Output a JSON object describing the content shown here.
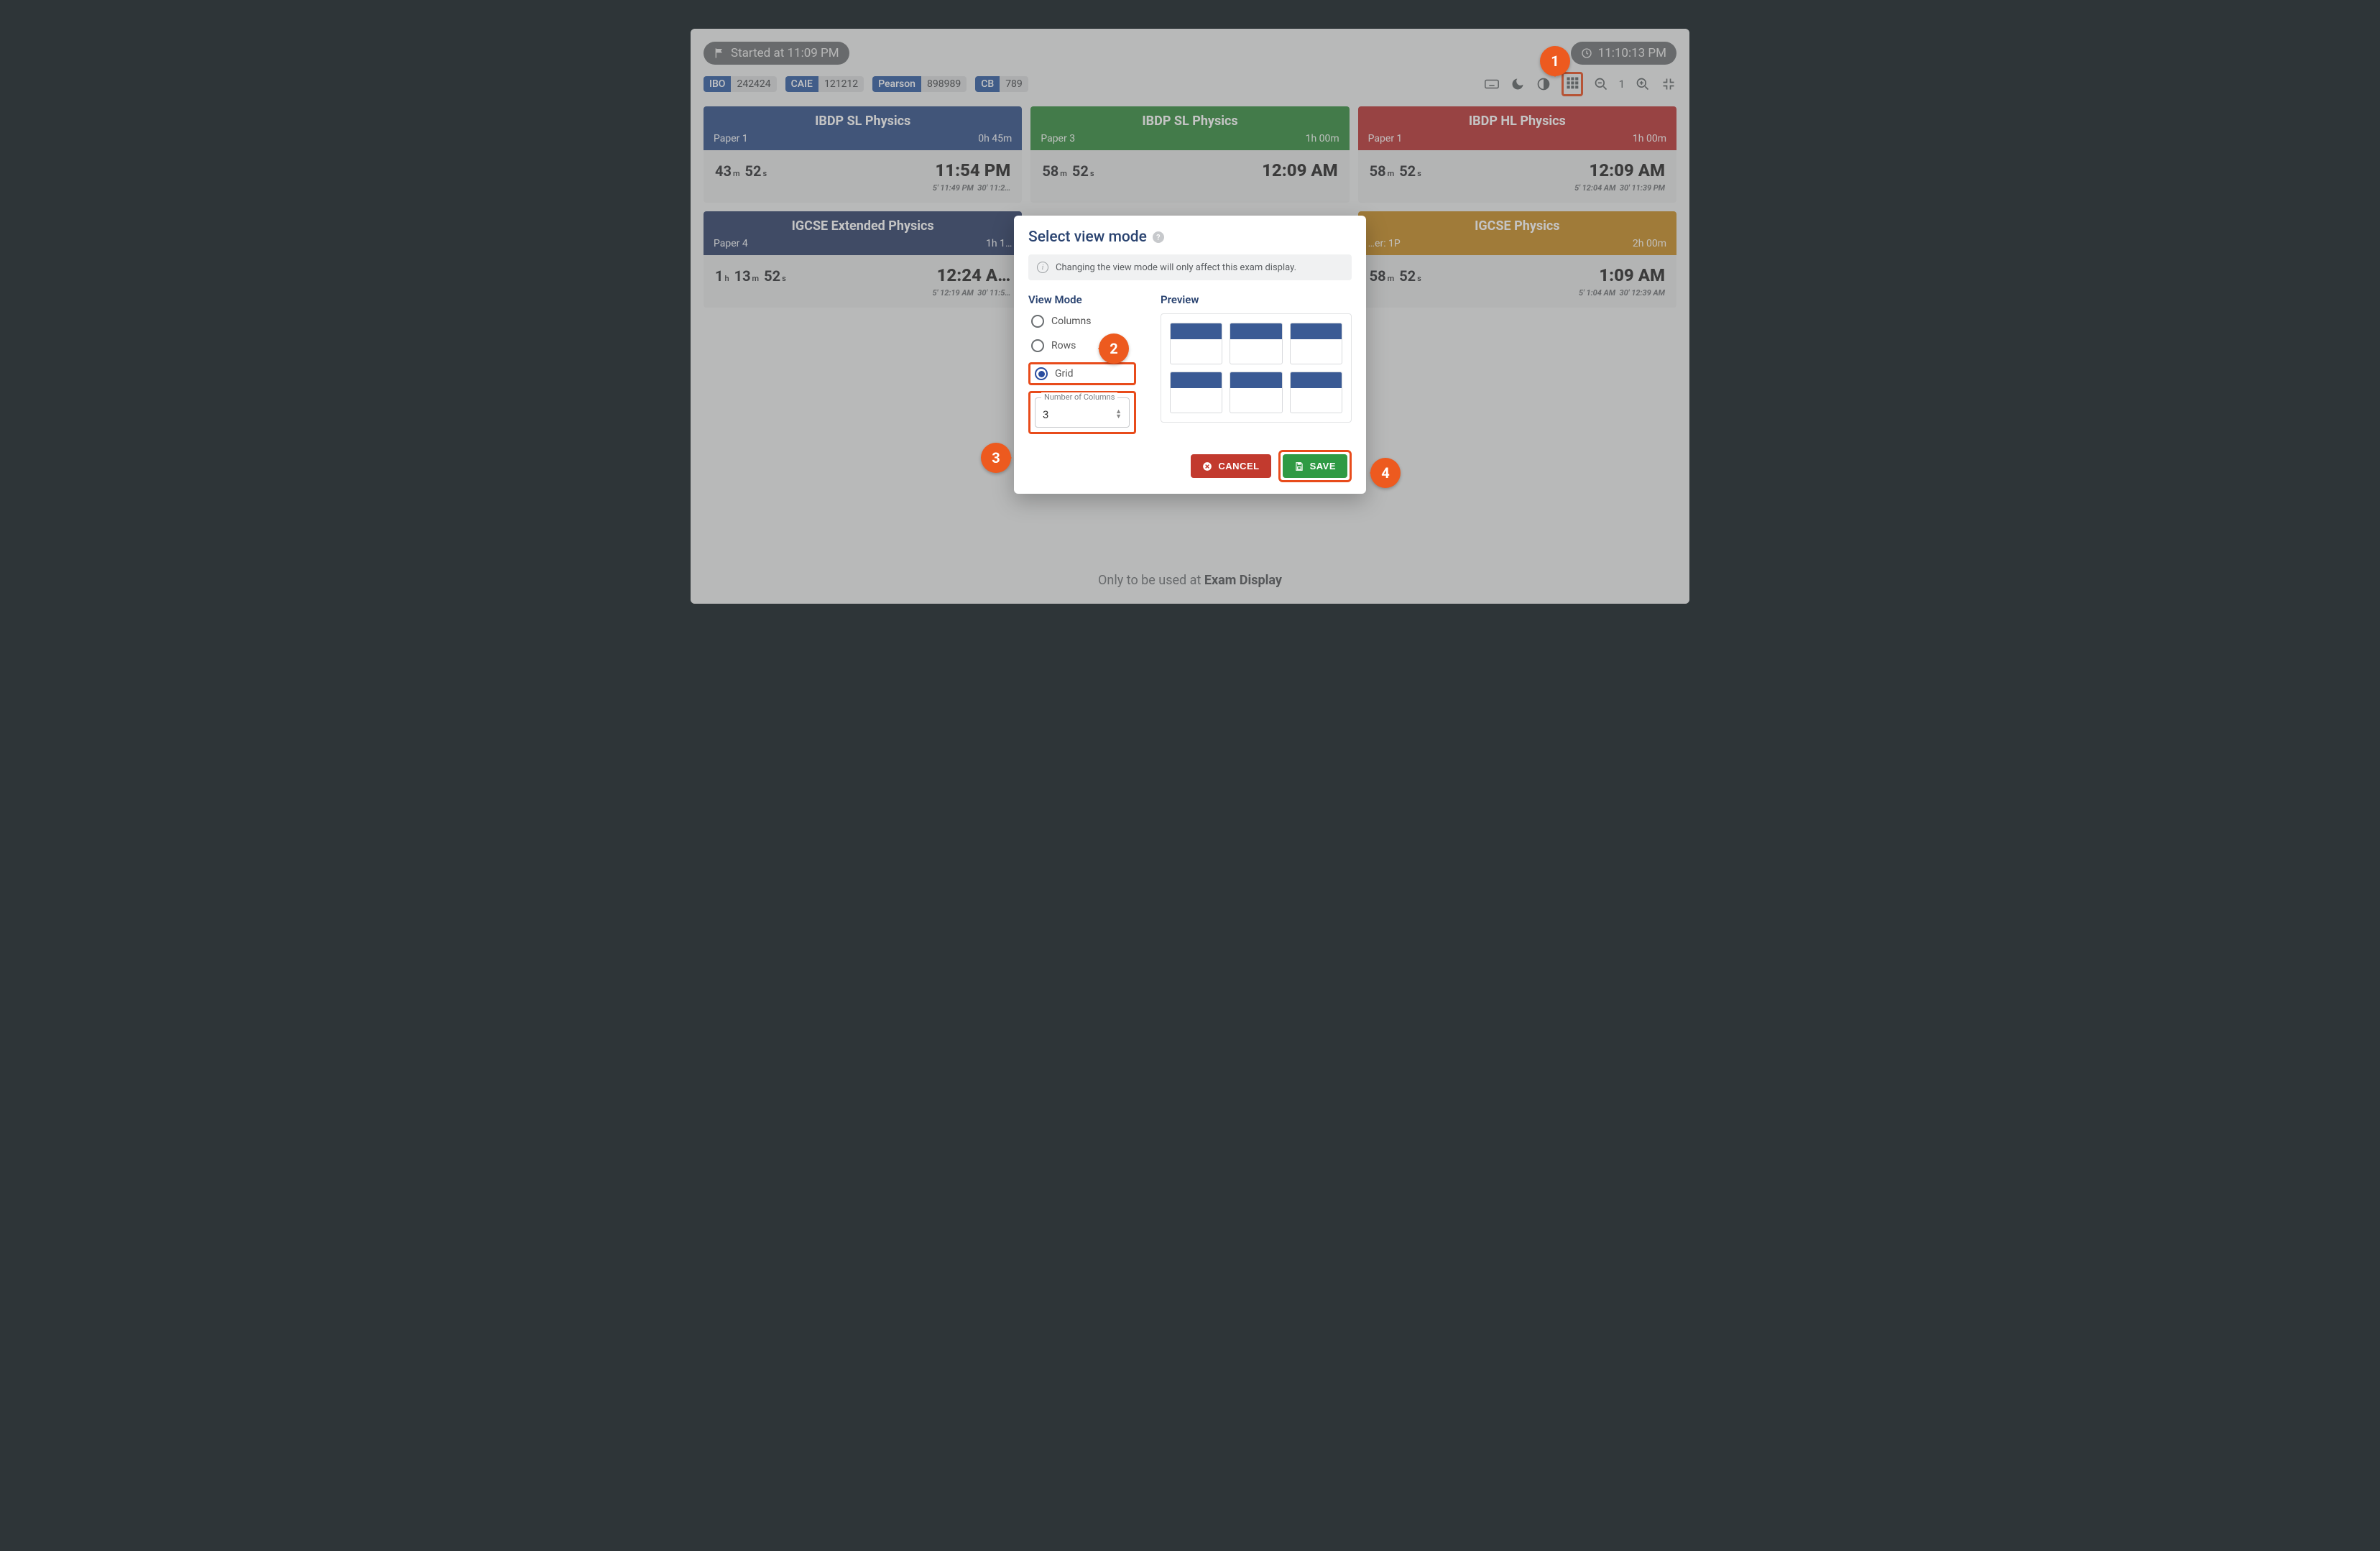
{
  "header": {
    "started_label": "Started at 11:09 PM",
    "clock": "11:10:13 PM"
  },
  "badges": [
    {
      "label": "IBO",
      "value": "242424",
      "cls": "ibo"
    },
    {
      "label": "CAIE",
      "value": "121212",
      "cls": "caie"
    },
    {
      "label": "Pearson",
      "value": "898989",
      "cls": "pearson"
    },
    {
      "label": "CB",
      "value": "789",
      "cls": "cb"
    }
  ],
  "toolbar": {
    "zoom_level": "1"
  },
  "cards": [
    {
      "hdr_cls": "blue",
      "title": "IBDP SL Physics",
      "paper": "Paper 1",
      "dur": "0h 45m",
      "rem_h": "",
      "rem_m": "43",
      "rem_s": "52",
      "end": "11:54 PM",
      "t5": "5' 11:49 PM",
      "t30": "30' 11:2…"
    },
    {
      "hdr_cls": "green",
      "title": "IBDP SL Physics",
      "paper": "Paper 3",
      "dur": "1h 00m",
      "rem_h": "",
      "rem_m": "58",
      "rem_s": "52",
      "end": "12:09 AM",
      "t5": "",
      "t30": ""
    },
    {
      "hdr_cls": "red",
      "title": "IBDP HL Physics",
      "paper": "Paper 1",
      "dur": "1h 00m",
      "rem_h": "",
      "rem_m": "58",
      "rem_s": "52",
      "end": "12:09 AM",
      "t5": "5' 12:04 AM",
      "t30": "30' 11:39 PM"
    },
    {
      "hdr_cls": "navy",
      "title": "IGCSE Extended Physics",
      "paper": "Paper 4",
      "dur": "1h 1…",
      "rem_h": "1",
      "rem_m": "13",
      "rem_s": "52",
      "end": "12:24 A…",
      "t5": "5' 12:19 AM",
      "t30": "30' 11:5…"
    },
    {
      "hdr_cls": "blue",
      "title": "",
      "paper": "",
      "dur": "",
      "rem_h": "",
      "rem_m": "",
      "rem_s": "",
      "end": "",
      "t5": "",
      "t30": ""
    },
    {
      "hdr_cls": "orange",
      "title": "IGCSE Physics",
      "paper": "…er: 1P",
      "dur": "2h 00m",
      "rem_h": "",
      "rem_m": "58",
      "rem_s": "52",
      "end": "1:09 AM",
      "t5": "5' 1:04 AM",
      "t30": "30' 12:39 AM"
    }
  ],
  "footer": {
    "prefix": "Only to be used at ",
    "bold": "Exam Display"
  },
  "modal": {
    "title": "Select view mode",
    "info": "Changing the view mode will only affect this exam display.",
    "section_mode": "View Mode",
    "section_preview": "Preview",
    "opt_columns": "Columns",
    "opt_rows": "Rows",
    "opt_grid": "Grid",
    "numcol_legend": "Number of Columns",
    "numcol_value": "3",
    "cancel": "CANCEL",
    "save": "SAVE"
  },
  "annotations": {
    "a1": "1",
    "a2": "2",
    "a3": "3",
    "a4": "4"
  }
}
